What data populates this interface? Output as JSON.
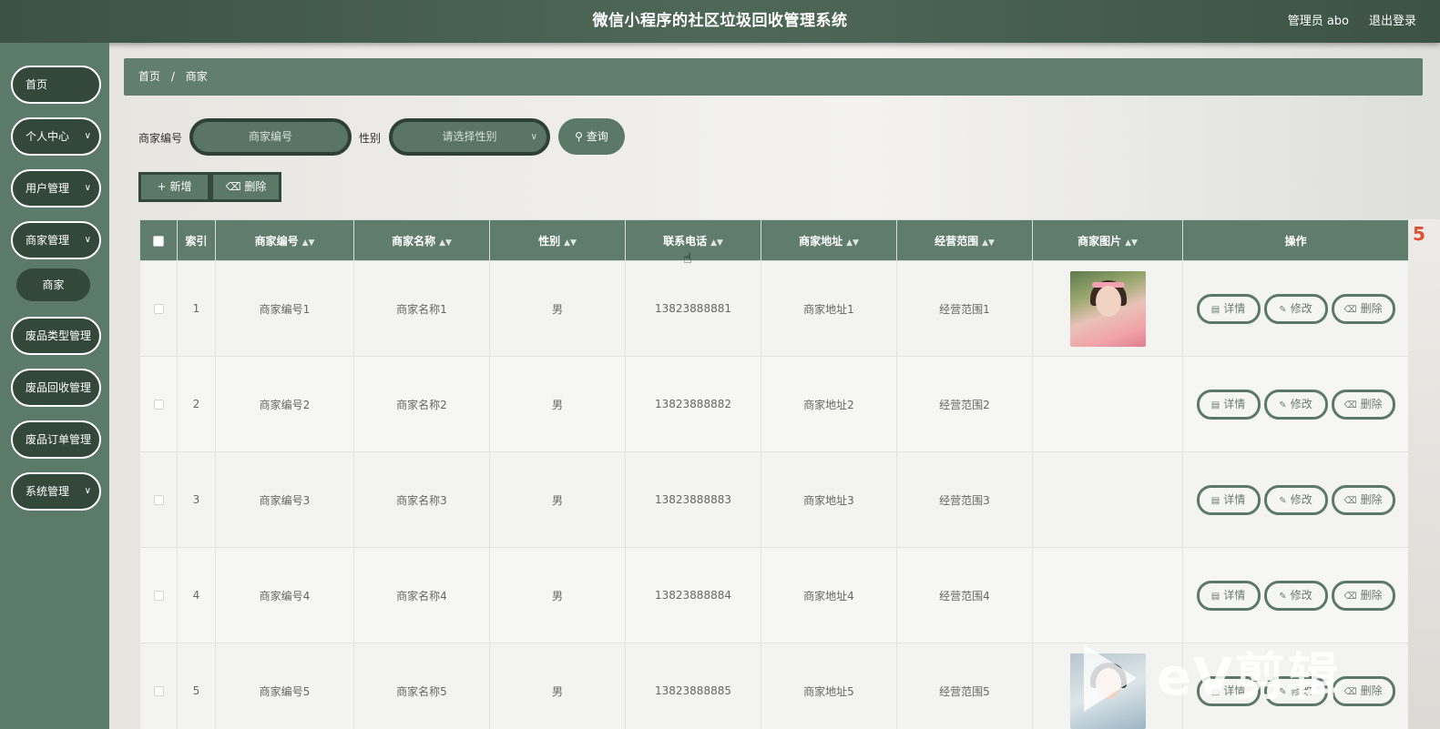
{
  "header": {
    "title": "微信小程序的社区垃圾回收管理系统",
    "user": "管理员 abo",
    "logout": "退出登录"
  },
  "sidebar": {
    "items": [
      {
        "label": "首页",
        "has_children": false
      },
      {
        "label": "个人中心",
        "has_children": true
      },
      {
        "label": "用户管理",
        "has_children": true
      },
      {
        "label": "商家管理",
        "has_children": true
      },
      {
        "label": "废品类型管理",
        "has_children": true
      },
      {
        "label": "废品回收管理",
        "has_children": true
      },
      {
        "label": "废品订单管理",
        "has_children": true
      },
      {
        "label": "系统管理",
        "has_children": true
      }
    ],
    "active_sub": "商家"
  },
  "breadcrumb": {
    "home": "首页",
    "sep": "/",
    "current": "商家"
  },
  "search": {
    "merchant_no_label": "商家编号",
    "merchant_no_placeholder": "商家编号",
    "gender_label": "性别",
    "gender_placeholder": "请选择性别",
    "query_button": "查询"
  },
  "actions": {
    "add": "新增",
    "delete": "删除"
  },
  "table": {
    "columns": [
      "索引",
      "商家编号",
      "商家名称",
      "性别",
      "联系电话",
      "商家地址",
      "经营范围",
      "商家图片",
      "操作"
    ],
    "rows": [
      {
        "index": "1",
        "no": "商家编号1",
        "name": "商家名称1",
        "gender": "男",
        "phone": "13823888881",
        "address": "商家地址1",
        "scope": "经营范围1",
        "has_image": true
      },
      {
        "index": "2",
        "no": "商家编号2",
        "name": "商家名称2",
        "gender": "男",
        "phone": "13823888882",
        "address": "商家地址2",
        "scope": "经营范围2",
        "has_image": false
      },
      {
        "index": "3",
        "no": "商家编号3",
        "name": "商家名称3",
        "gender": "男",
        "phone": "13823888883",
        "address": "商家地址3",
        "scope": "经营范围3",
        "has_image": false
      },
      {
        "index": "4",
        "no": "商家编号4",
        "name": "商家名称4",
        "gender": "男",
        "phone": "13823888884",
        "address": "商家地址4",
        "scope": "经营范围4",
        "has_image": false
      },
      {
        "index": "5",
        "no": "商家编号5",
        "name": "商家名称5",
        "gender": "男",
        "phone": "13823888885",
        "address": "商家地址5",
        "scope": "经营范围5",
        "has_image": true
      }
    ],
    "row_actions": {
      "detail": "详情",
      "edit": "修改",
      "delete": "删除"
    }
  },
  "watermark": "eV剪辑",
  "icons": {
    "search": "search-icon",
    "plus": "plus-icon",
    "trash": "trash-icon",
    "detail": "document-icon",
    "edit": "pencil-icon",
    "chevron": "chevron-down-icon",
    "sort": "sort-icon"
  },
  "colors": {
    "header": "#4e6858",
    "sidebar": "#5c7a6a",
    "primary": "#5b7868",
    "dark": "#34473b"
  }
}
